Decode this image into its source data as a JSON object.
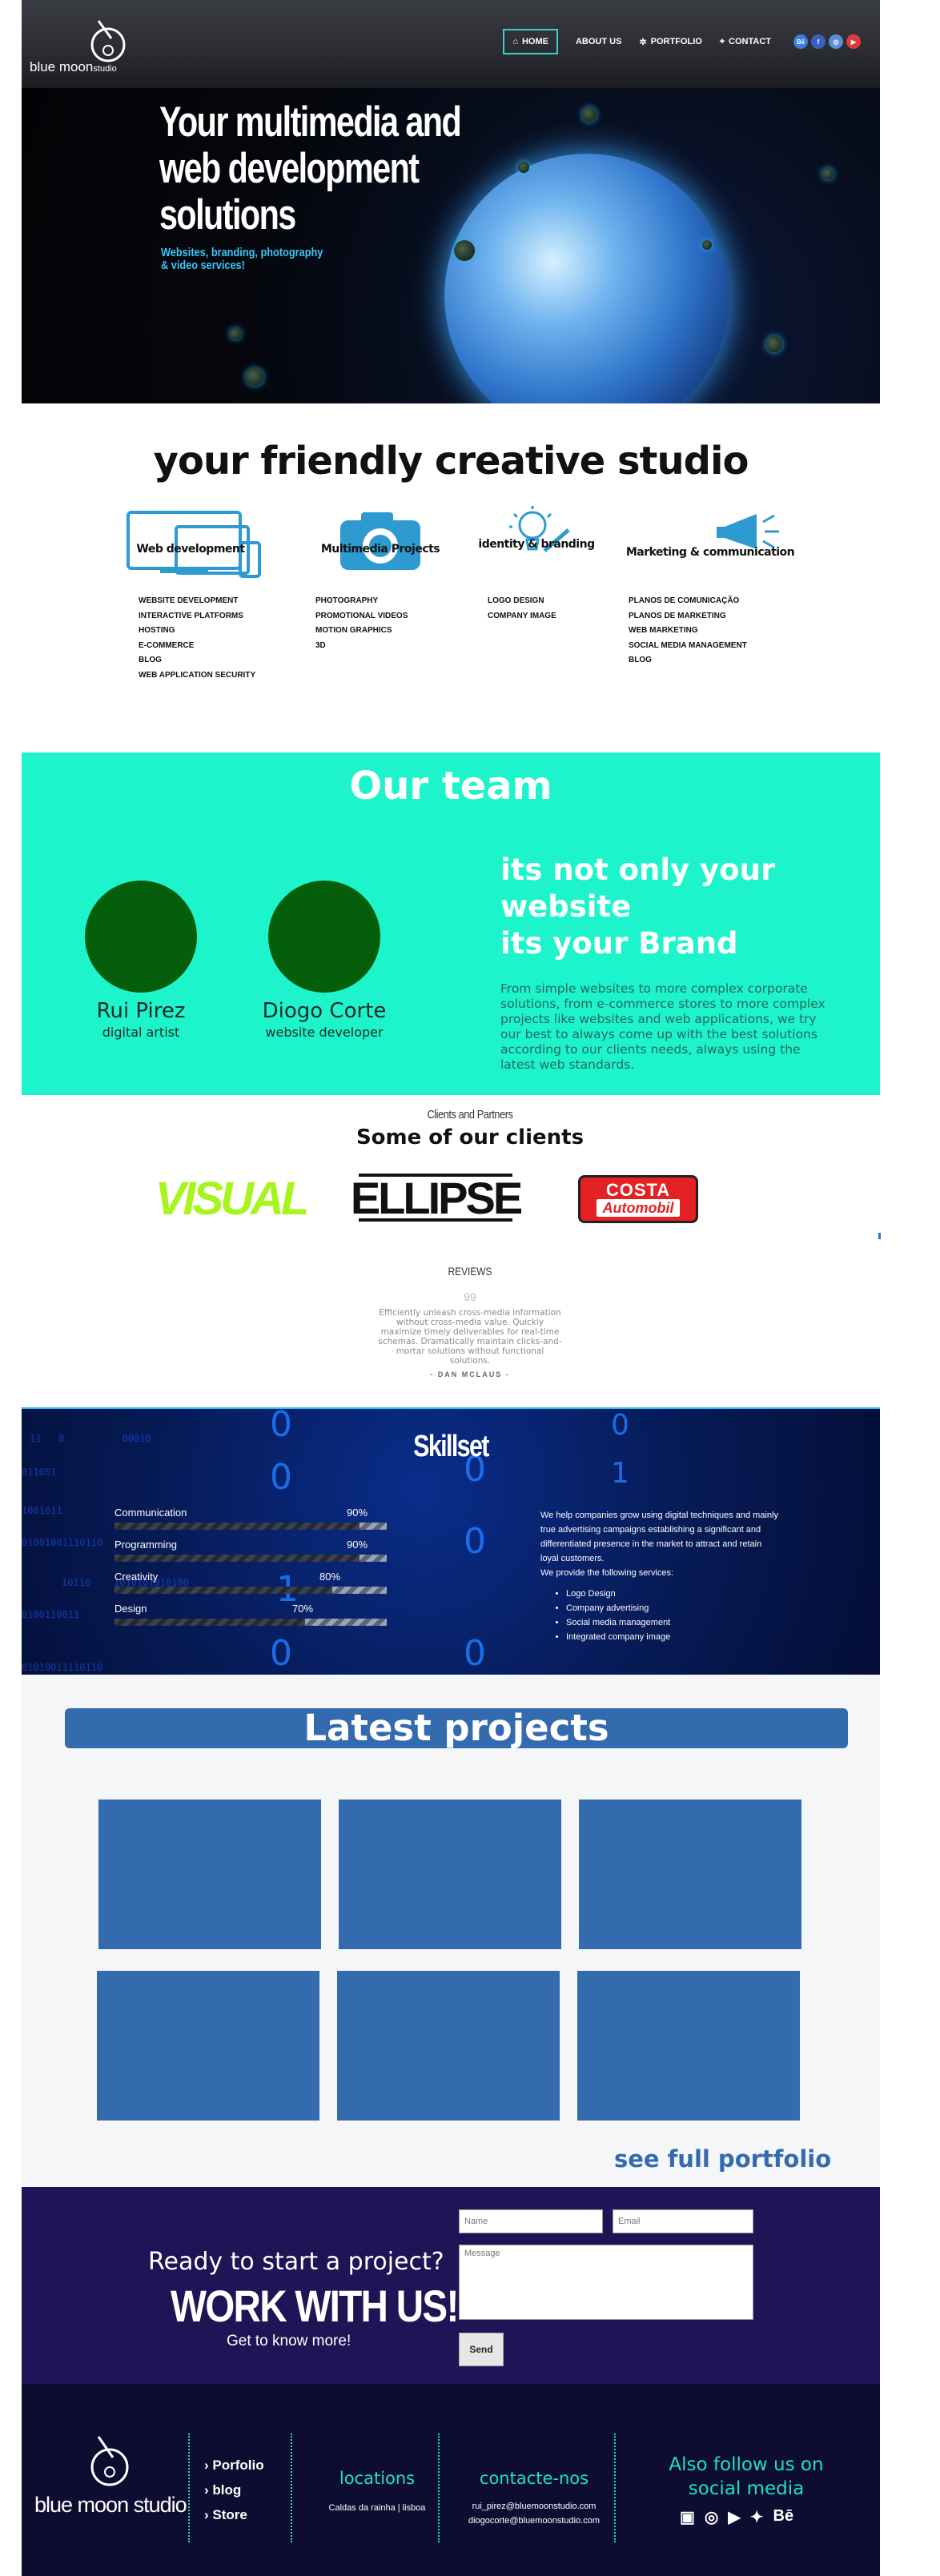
{
  "header": {
    "logo_name": "blue moon",
    "logo_suffix": "studio",
    "nav": [
      {
        "label": "HOME",
        "icon": "home-icon"
      },
      {
        "label": "ABOUT US"
      },
      {
        "label": "PORTFOLIO",
        "icon": "gear-icon"
      },
      {
        "label": "CONTACT",
        "icon": "pin-icon"
      }
    ],
    "social": [
      {
        "name": "behance-icon",
        "glyph": "Bē",
        "color": "#3b7de0"
      },
      {
        "name": "facebook-icon",
        "glyph": "f",
        "color": "#3b5fbf"
      },
      {
        "name": "instagram-icon",
        "glyph": "◎",
        "color": "#5a8fd8"
      },
      {
        "name": "youtube-icon",
        "glyph": "▶",
        "color": "#e03b3b"
      }
    ]
  },
  "hero": {
    "title": "Your multimedia and web development solutions",
    "subtitle": "Websites, branding, photography & video services!"
  },
  "services": {
    "title": "your friendly creative studio",
    "items": [
      {
        "label": "Web development",
        "list": [
          "WEBSITE DEVELOPMENT",
          "INTERACTIVE PLATFORMS",
          "HOSTING",
          "E-COMMERCE",
          "BLOG",
          "WEB APPLICATION SECURITY"
        ]
      },
      {
        "label": "Multimedia Projects",
        "list": [
          "PHOTOGRAPHY",
          "PROMOTIONAL VIDEOS",
          "MOTION GRAPHICS",
          "3D"
        ]
      },
      {
        "label": "identity & branding",
        "list": [
          "LOGO DESIGN",
          "COMPANY IMAGE"
        ]
      },
      {
        "label": "Marketing & communication",
        "list": [
          "PLANOS DE COMUNICAÇÃO",
          "PLANOS DE MARKETING",
          "WEB MARKETING",
          "SOCIAL MEDIA MANAGEMENT",
          "BLOG"
        ]
      }
    ]
  },
  "team": {
    "title": "Our team",
    "members": [
      {
        "name": "Rui Pirez",
        "role": "digital artist"
      },
      {
        "name": "Diogo Corte",
        "role": "website developer"
      }
    ],
    "brand_lines": [
      "its not only your",
      "website",
      "its your Brand"
    ],
    "brand_text": "From simple websites to more complex corporate solutions, from e-commerce stores to more complex projects like websites and web applications, we try our best to always come up  with the best solutions according to our clients needs, always using the latest web standards."
  },
  "clients": {
    "small_title": "Clients and Partners",
    "title": "Some of our clients",
    "logos": [
      "VISUAL",
      "ELLIPSE",
      "COSTA",
      "Automobil"
    ]
  },
  "reviews": {
    "title": "REVIEWS",
    "quote_mark": "99",
    "text": "Efficiently unleash cross-media information without cross-media value. Quickly maximize timely deliverables for real-time schemas. Dramatically maintain clicks-and-mortar solutions without functional solutions.",
    "author": "- DAN MCLAUS -"
  },
  "skillset": {
    "title": "Skillset",
    "skills": [
      {
        "label": "Communication",
        "pct": "90%",
        "value": 90
      },
      {
        "label": "Programming",
        "pct": "90%",
        "value": 90
      },
      {
        "label": "Creativity",
        "pct": "80%",
        "value": 80
      },
      {
        "label": "Design",
        "pct": "70%",
        "value": 70
      }
    ],
    "desc": "We help companies grow using digital techniques and mainly true advertising campaigns establishing a significant and differentiated presence in the market to attract and retain loyal customers.",
    "services_intro": "We provide the following services:",
    "services": [
      "Logo Design",
      "Company advertising",
      "Social media management",
      "Integrated company image"
    ]
  },
  "projects": {
    "title": "Latest projects",
    "tiles": 6,
    "see_full": "see full portfolio",
    "tile_color": "#346aae"
  },
  "contact": {
    "ready": "Ready to start a project?",
    "work": "WORK WITH US!",
    "know": "Get to know more!",
    "name_placeholder": "Name",
    "email_placeholder": "Email",
    "message_placeholder": "Message",
    "send": "Send"
  },
  "footer": {
    "logo": "blue moon studio",
    "links": [
      "Porfolio",
      "blog",
      "Store"
    ],
    "locations_title": "locations",
    "locations_text": "Caldas da rainha | lisboa",
    "contact_title": "contacte-nos",
    "emails": [
      "rui_pirez@bluemoonstudio.com",
      "diogocorte@bluemoonstudio.com"
    ],
    "follow_line1": "Also follow us on",
    "follow_line2": "social media",
    "social": [
      "facebook-icon",
      "whatsapp-icon",
      "youtube-icon",
      "twitter-icon",
      "behance-icon"
    ]
  },
  "colors": {
    "accent_teal": "#1ef4cb",
    "brand_blue": "#346aae",
    "contact_bg": "#1f1455",
    "footer_bg": "#0f0c32"
  }
}
